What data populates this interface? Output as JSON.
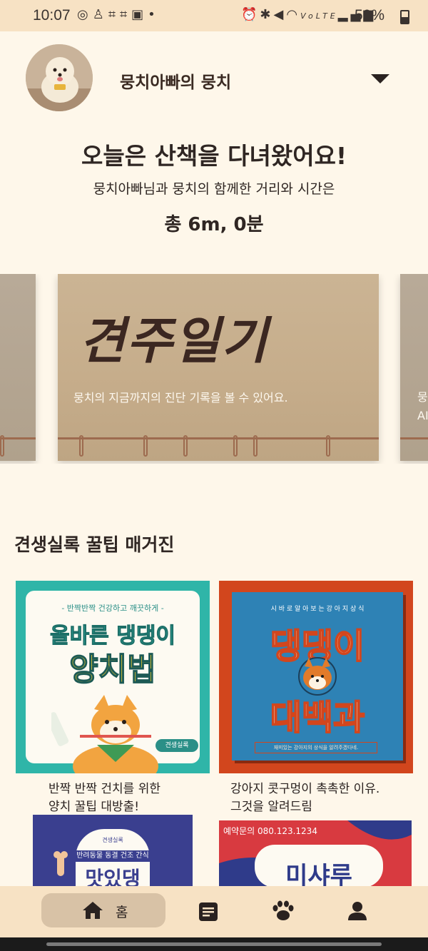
{
  "status_bar": {
    "time": "10:07",
    "battery": "50%",
    "left_icons": [
      "instagram-icon",
      "notification-icon",
      "screenshot-icon",
      "screenshot-icon",
      "gallery-icon",
      "dot-icon"
    ],
    "right_icons": [
      "alarm-icon",
      "bluetooth-icon",
      "mute-icon",
      "wifi-icon",
      "volte-icon",
      "signal-icon",
      "battery-icon"
    ]
  },
  "profile": {
    "pet_name": "뭉치아빠의 뭉치"
  },
  "summary": {
    "headline": "오늘은 산책을 다녀왔어요!",
    "subline": "뭉치아빠님과 뭉치의 함께한 거리와 시간은",
    "total": "총 6m, 0분"
  },
  "carousel": {
    "main_card": {
      "title": "견주일기",
      "description": "뭉치의 지금까지의 진단 기록을 볼 수 있어요."
    },
    "next_card": {
      "text_line1": "뭉",
      "text_line2": "AI"
    }
  },
  "magazine": {
    "section_title": "견생실록 꿀팁 매거진",
    "items": [
      {
        "caption_line1": "반짝 반짝 건치를 위한",
        "caption_line2": "양치 꿀팁 대방출!",
        "cover_top": "- 반짝반짝 건강하고 깨끗하게 -",
        "cover_title1": "올바른 댕댕이",
        "cover_title2": "양치법",
        "brand": "견생실록",
        "bg": "#2fb5a8"
      },
      {
        "caption_line1": "강아지 콧구멍이 촉촉한 이유.",
        "caption_line2": "그것을 알려드림",
        "cover_top": "시 바 로 알 아 보 는  강 아 지  상 식",
        "cover_title1": "댕댕이",
        "cover_title2": "대백과",
        "cover_bottom": "재미있는 강아지의 상식을 알려주겠다네.",
        "bg": "#d2461d"
      },
      {
        "cover_top": "견생실록",
        "cover_title1": "반려동물 동결 건조 간식",
        "cover_title2": "맛있댕",
        "bg": "#3a3f8f"
      },
      {
        "cover_top": "예약문의 080.123.1234",
        "cover_title1": "미샤루",
        "bg": "#d83a40"
      }
    ]
  },
  "bottom_nav": {
    "home_label": "홈",
    "items": [
      "home-icon",
      "diary-icon",
      "paw-icon",
      "profile-icon"
    ]
  },
  "colors": {
    "background": "#fef7ea",
    "nav_bg": "#f7e2c4",
    "pill": "#d8c2a6",
    "text": "#2a2220"
  }
}
